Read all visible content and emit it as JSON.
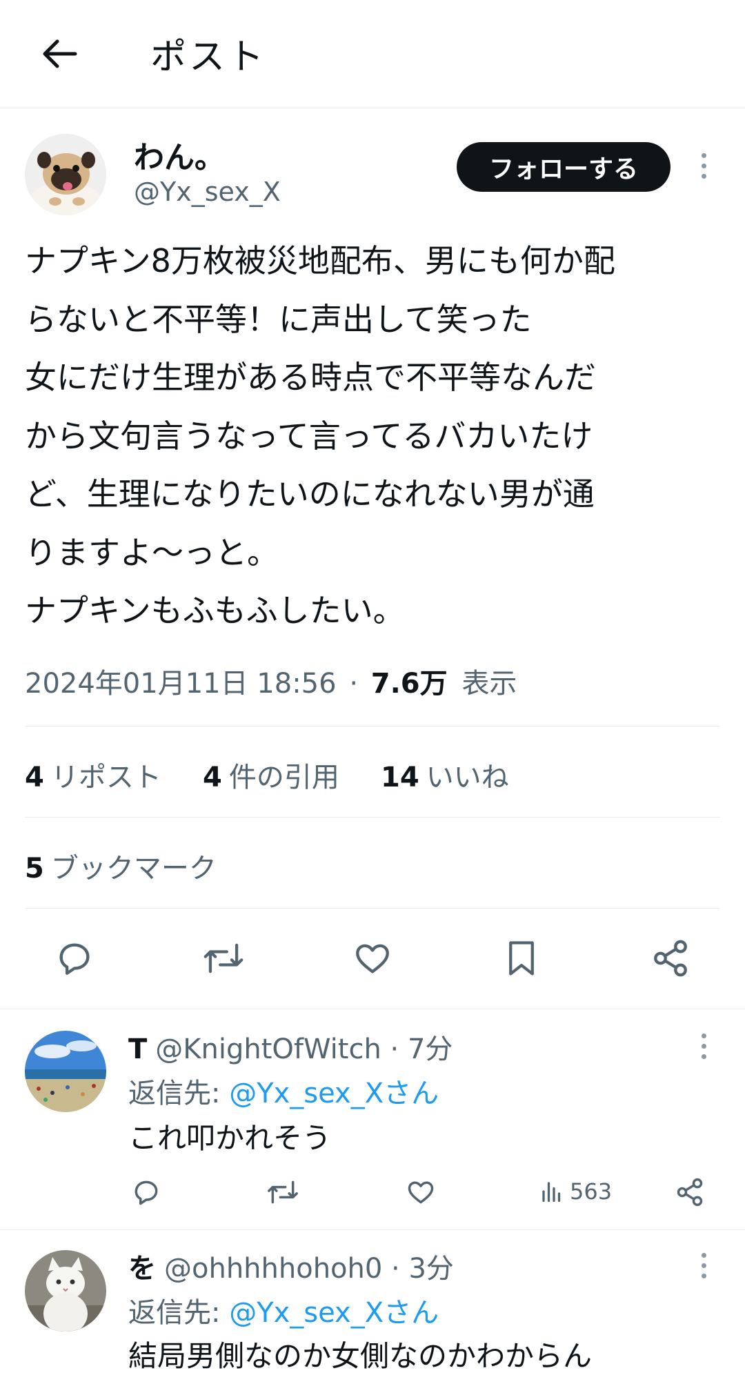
{
  "header": {
    "title": "ポスト"
  },
  "post": {
    "author_name": "わん。",
    "author_handle": "@Yx_sex_X",
    "follow_label": "フォローする",
    "lines": [
      "ナプキン8万枚被災地配布、男にも何か配",
      "らないと不平等！に声出して笑った",
      "女にだけ生理がある時点で不平等なんだ",
      "から文句言うなって言ってるバカいたけ",
      "ど、生理になりたいのになれない男が通",
      "りますよ〜っと。",
      "ナプキンもふもふしたい。"
    ],
    "timestamp": "2024年01月11日 18:56",
    "separator": "·",
    "views_count": "7.6万",
    "views_label": "表示"
  },
  "stats": {
    "reposts_count": "4",
    "reposts_label": "リポスト",
    "quotes_count": "4",
    "quotes_label": "件の引用",
    "likes_count": "14",
    "likes_label": "いいね",
    "bookmarks_count": "5",
    "bookmarks_label": "ブックマーク"
  },
  "replies": [
    {
      "name": "T",
      "handle": "@KnightOfWitch · 7分",
      "reply_prefix": "返信先: ",
      "reply_to": "@Yx_sex_Xさん",
      "text": "これ叩かれそう",
      "views": "563"
    },
    {
      "name": "を",
      "handle": "@ohhhhhohoh0 · 3分",
      "reply_prefix": "返信先: ",
      "reply_to": "@Yx_sex_Xさん",
      "text": "結局男側なのか女側なのかわからん"
    }
  ],
  "colors": {
    "accent": "#1d9bf0",
    "text": "#0f1419",
    "muted": "#536471",
    "border": "#e7e9ea"
  },
  "icons": [
    "back-arrow-icon",
    "more-icon",
    "reply-icon",
    "retweet-icon",
    "like-icon",
    "bookmark-icon",
    "share-icon",
    "views-icon"
  ]
}
